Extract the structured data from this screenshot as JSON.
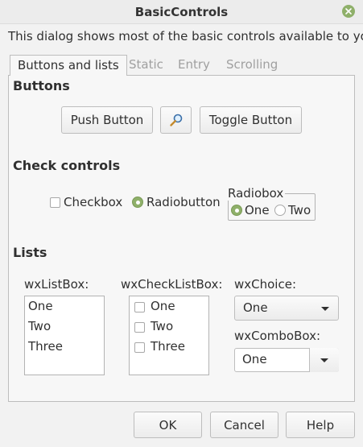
{
  "window": {
    "title": "BasicControls"
  },
  "description": "This dialog shows most of the basic controls available to you.",
  "tabs": [
    {
      "label": "Buttons and lists",
      "active": true
    },
    {
      "label": "Static",
      "active": false
    },
    {
      "label": "Entry",
      "active": false
    },
    {
      "label": "Scrolling",
      "active": false
    }
  ],
  "buttons_section": {
    "title": "Buttons",
    "push_button": "Push Button",
    "icon_button_icon": "magnifier-icon",
    "toggle_button": "Toggle Button"
  },
  "check_section": {
    "title": "Check controls",
    "checkbox_label": "Checkbox",
    "checkbox_checked": false,
    "radiobutton_label": "Radiobutton",
    "radiobutton_checked": true,
    "radiobox": {
      "title": "Radiobox",
      "options": [
        {
          "label": "One",
          "selected": true
        },
        {
          "label": "Two",
          "selected": false
        }
      ]
    }
  },
  "lists_section": {
    "title": "Lists",
    "listbox": {
      "label": "wxListBox:",
      "items": [
        "One",
        "Two",
        "Three"
      ]
    },
    "checklistbox": {
      "label": "wxCheckListBox:",
      "items": [
        "One",
        "Two",
        "Three"
      ]
    },
    "choice": {
      "label": "wxChoice:",
      "value": "One"
    },
    "combobox": {
      "label": "wxComboBox:",
      "value": "One"
    }
  },
  "footer": {
    "ok": "OK",
    "cancel": "Cancel",
    "help": "Help"
  },
  "colors": {
    "accent": "#8fb06a",
    "background": "#f2f2f2",
    "panel": "#f7f7f7"
  }
}
